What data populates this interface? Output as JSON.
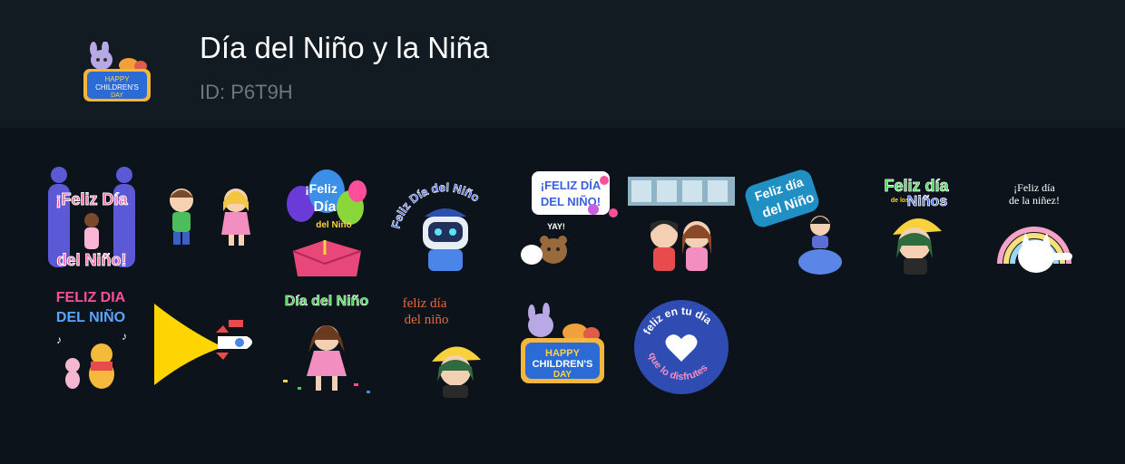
{
  "pack": {
    "title": "Día del Niño y la Niña",
    "id_label": "ID: P6T9H",
    "icon_text": [
      "HAPPY",
      "CHILDREN'S",
      "DAY"
    ]
  },
  "stickers": [
    {
      "name": "sticker-feliz-dia-del-nino-parents",
      "icon": "parents-child-icon",
      "texts": [
        "¡Feliz Día",
        "del Niño!"
      ]
    },
    {
      "name": "sticker-boy-and-girl",
      "icon": "boy-girl-icon",
      "texts": []
    },
    {
      "name": "sticker-feliz-dia-balloons-box",
      "icon": "balloons-gift-box-icon",
      "texts": [
        "¡Feliz",
        "Día",
        "del Niño"
      ]
    },
    {
      "name": "sticker-feliz-dia-del-nino-robot",
      "icon": "robot-icon",
      "texts": [
        "Feliz Día del Niño"
      ]
    },
    {
      "name": "sticker-feliz-dia-del-nino-bears",
      "icon": "bears-icon",
      "texts": [
        "¡FELIZ DÍA",
        "DEL NIÑO!",
        "YAY!"
      ]
    },
    {
      "name": "sticker-kids-banner",
      "icon": "kids-banner-icon",
      "texts": []
    },
    {
      "name": "sticker-feliz-dia-del-nino-ball",
      "icon": "boy-on-ball-icon",
      "texts": [
        "Feliz día",
        "del Niño"
      ]
    },
    {
      "name": "sticker-feliz-dia-ninos-girl",
      "icon": "girl-yellow-hat-icon",
      "texts": [
        "Feliz día",
        "de los",
        "Niños"
      ]
    },
    {
      "name": "sticker-feliz-dia-unicorn",
      "icon": "unicorn-cat-icon",
      "texts": [
        "¡Feliz día",
        "de la niñez!"
      ]
    },
    {
      "name": "sticker-feliz-dia-del-nino-pooh",
      "icon": "pooh-piglet-icon",
      "texts": [
        "FELIZ DIA",
        "DEL NIÑO"
      ]
    },
    {
      "name": "sticker-rocket-beam",
      "icon": "rocket-icon",
      "texts": []
    },
    {
      "name": "sticker-dia-del-nino-girl",
      "icon": "girl-confetti-icon",
      "texts": [
        "Día del Niño"
      ]
    },
    {
      "name": "sticker-feliz-dia-del-nino-hat",
      "icon": "girl-hat-icon",
      "texts": [
        "feliz día",
        "del niño"
      ]
    },
    {
      "name": "sticker-happy-childrens-day",
      "icon": "toys-icon",
      "texts": [
        "HAPPY",
        "CHILDREN'S",
        "DAY"
      ]
    },
    {
      "name": "sticker-feliz-en-tu-dia",
      "icon": "heart-icon",
      "texts": [
        "feliz en tu día",
        "que lo disfrutes"
      ]
    }
  ],
  "colors": {
    "background": "#0c131a",
    "header": "#121a22",
    "title": "#ffffff",
    "id": "#6d7781"
  }
}
